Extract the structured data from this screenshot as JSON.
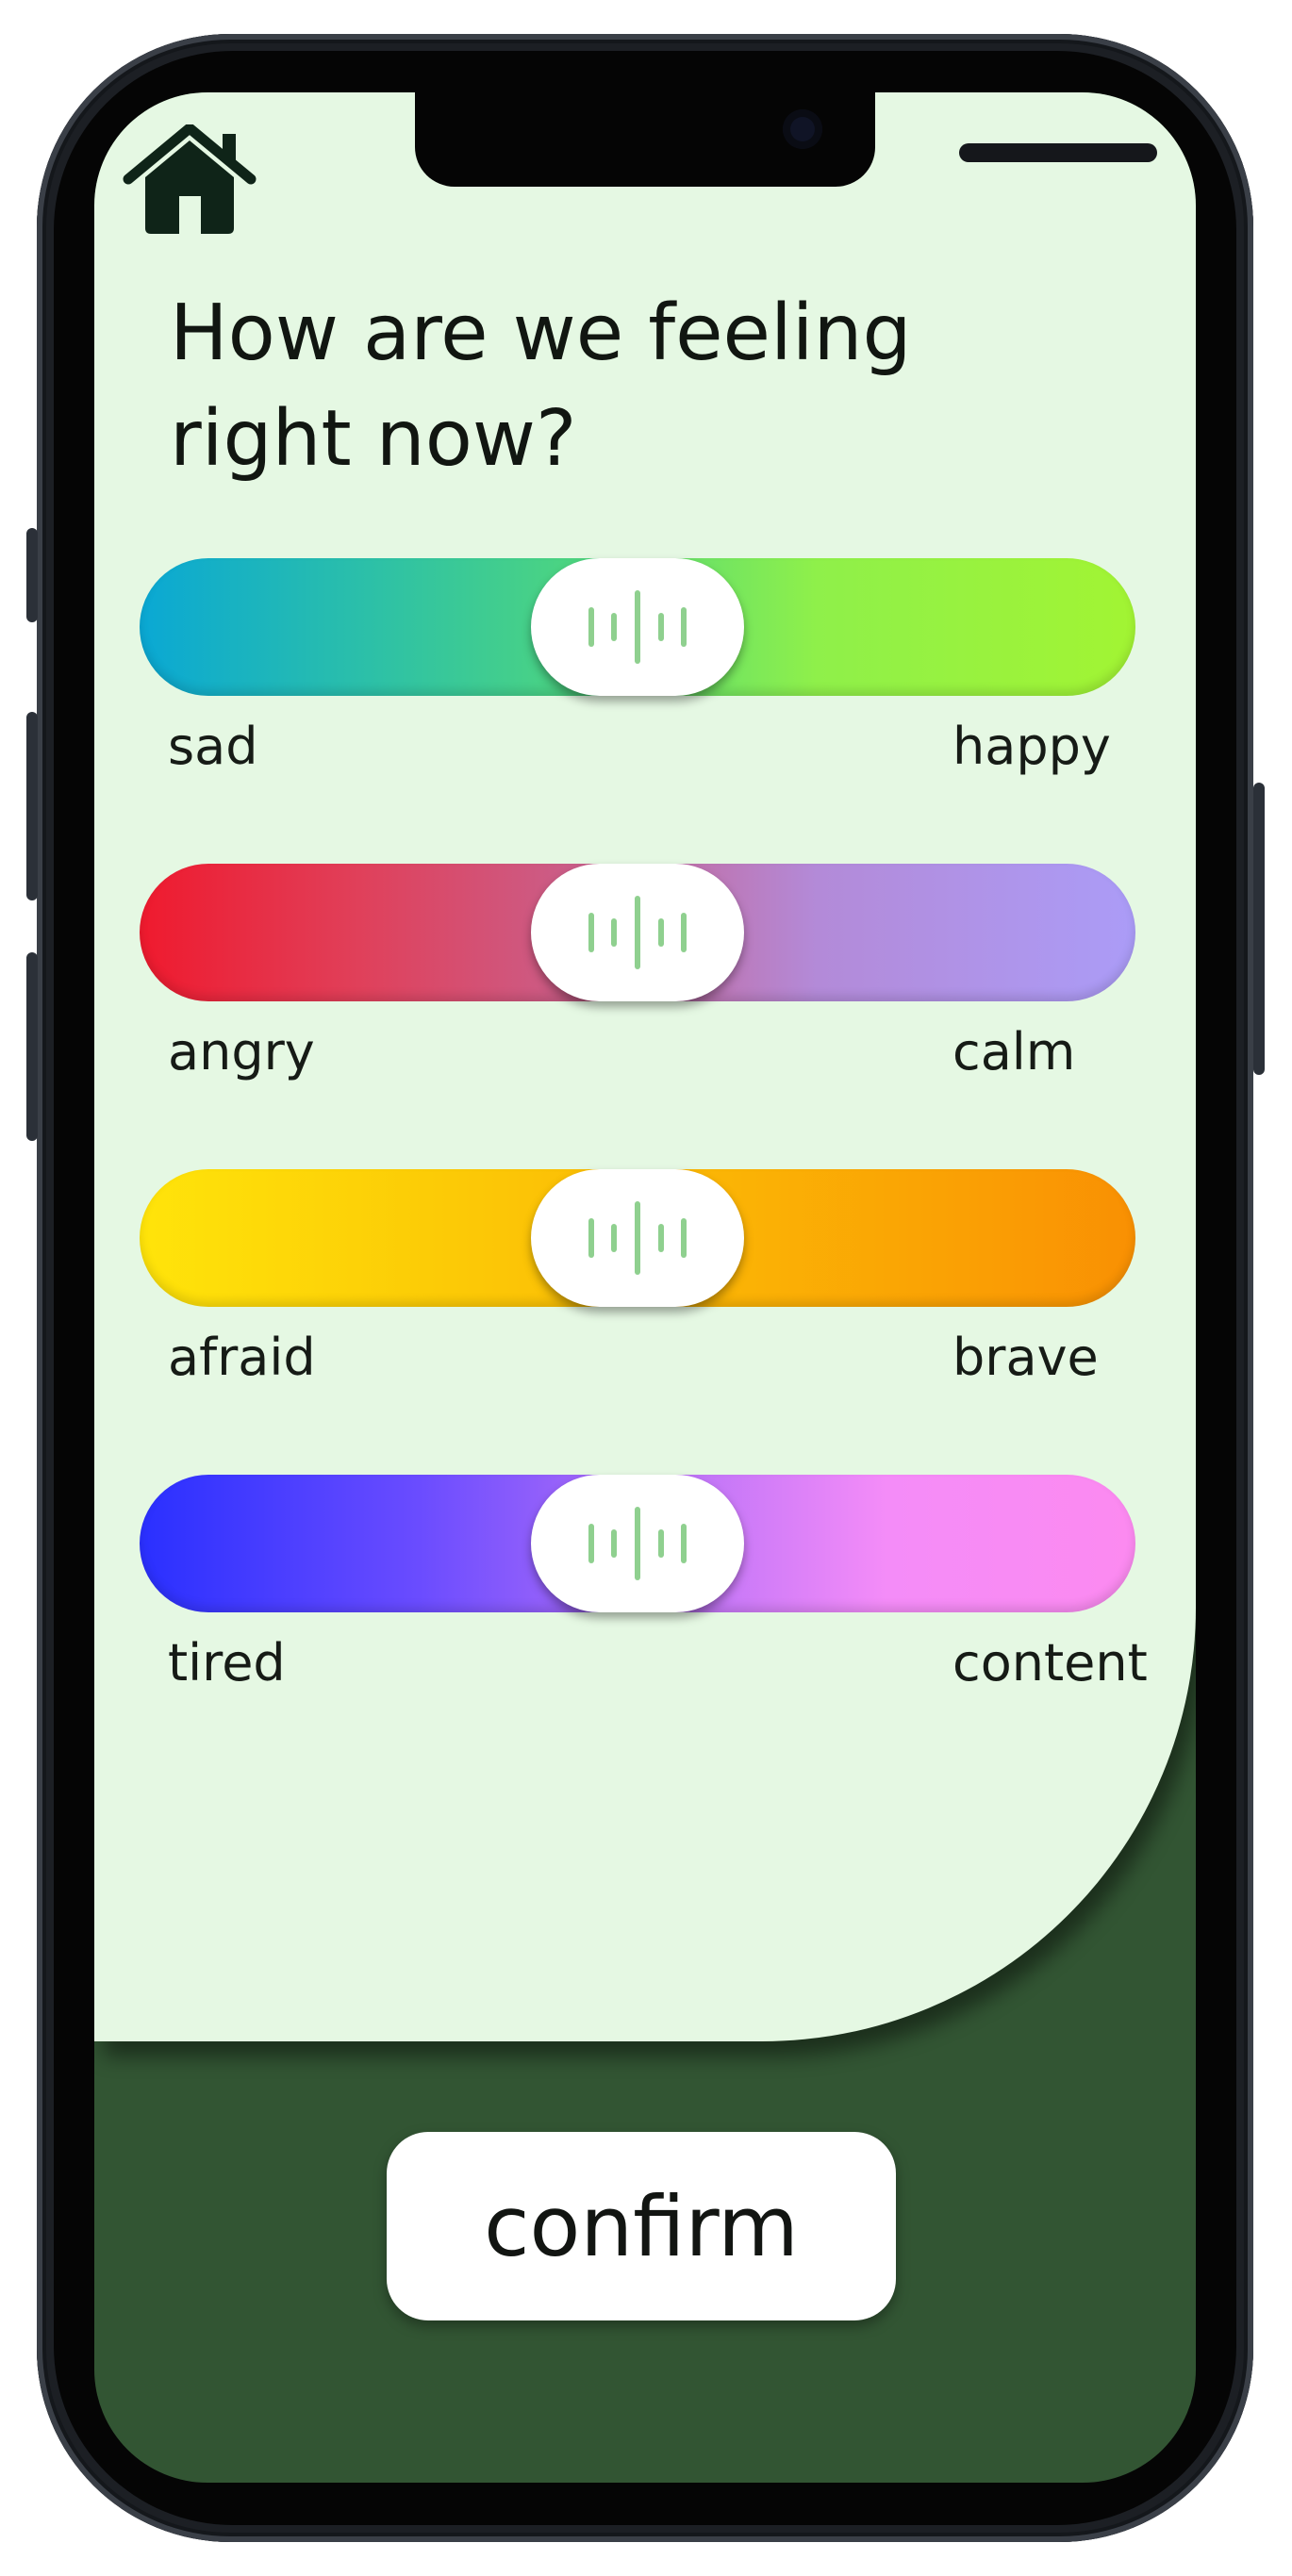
{
  "header": {
    "home_icon": "home-icon",
    "title": "How are we feeling right now?"
  },
  "sliders": [
    {
      "left_label": "sad",
      "right_label": "happy",
      "value": 0.5
    },
    {
      "left_label": "angry",
      "right_label": "calm",
      "value": 0.5
    },
    {
      "left_label": "afraid",
      "right_label": "brave",
      "value": 0.5
    },
    {
      "left_label": "tired",
      "right_label": "content",
      "value": 0.5
    }
  ],
  "confirm": {
    "label": "confirm"
  },
  "colors": {
    "panel_background": "#e5f8e3",
    "footer_background": "#325533",
    "thumb_grip": "#8fd08f"
  }
}
